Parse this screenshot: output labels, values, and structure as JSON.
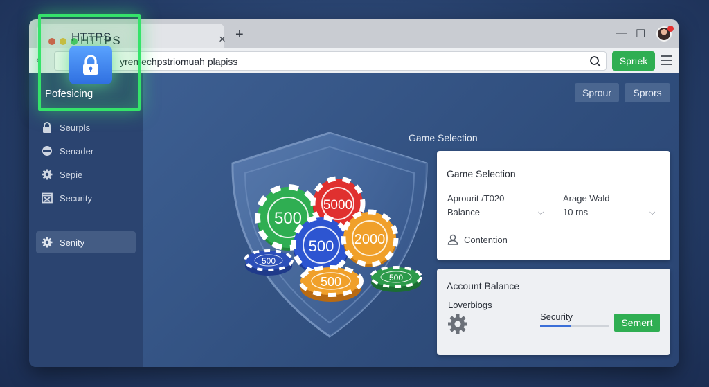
{
  "browser": {
    "tab_title": "HTTPS",
    "tab_close": "×",
    "new_tab": "+",
    "minimize": "—",
    "maximize": "☐",
    "url": "yremechpstriomuah plapiss",
    "search_button": "Sprıek"
  },
  "highlight": {
    "label": "Pofesicing",
    "icon": "lock-icon"
  },
  "sidebar": {
    "items": [
      {
        "label": "Seurpls",
        "icon": "lock-icon"
      },
      {
        "label": "Senader",
        "icon": "shield-icon"
      },
      {
        "label": "Sepie",
        "icon": "gear-icon"
      },
      {
        "label": "Security",
        "icon": "window-close-icon"
      },
      {
        "label": "Senity",
        "icon": "gear-icon",
        "active": true
      }
    ]
  },
  "toolbar": {
    "button1": "Sprour",
    "button2": "Sprors"
  },
  "hero": {
    "chips": [
      "500",
      "5000",
      "500",
      "2000",
      "500",
      "500",
      "500"
    ]
  },
  "game": {
    "section_title": "Game Selection",
    "card_title": "Game Selection",
    "field1_label": "Aprourit /T020",
    "field1_value": "Balance",
    "field2_label": "Arage Wald",
    "field2_value": "10 rns",
    "contention": "Contention"
  },
  "account": {
    "title": "Account Balance",
    "subtitle": "Loverbiogs",
    "security_label": "Security",
    "progress": 0.45,
    "button": "Semert"
  },
  "colors": {
    "accent_green": "#2fae52",
    "highlight_green": "#35e36a",
    "background": "#263f6a"
  }
}
